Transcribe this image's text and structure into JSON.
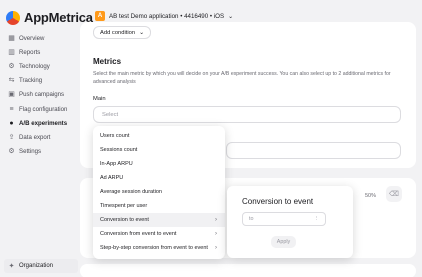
{
  "app": {
    "name": "AppMetrica",
    "title": "AB test Demo application • 4416490 • iOS",
    "badge": "A"
  },
  "sidebar": {
    "items": [
      {
        "label": "Overview",
        "icon": "overview-icon"
      },
      {
        "label": "Reports",
        "icon": "reports-icon"
      },
      {
        "label": "Technology",
        "icon": "technology-icon"
      },
      {
        "label": "Tracking",
        "icon": "tracking-icon"
      },
      {
        "label": "Push campaigns",
        "icon": "push-icon"
      },
      {
        "label": "Flag configuration",
        "icon": "flag-icon"
      },
      {
        "label": "A/B experiments",
        "icon": "ab-icon",
        "active": true
      },
      {
        "label": "Data export",
        "icon": "export-icon"
      },
      {
        "label": "Settings",
        "icon": "settings-icon"
      }
    ],
    "organization": "Organization"
  },
  "toolbar": {
    "add_condition": "Add condition"
  },
  "metrics": {
    "title": "Metrics",
    "description": "Select the main metric by which you will decide on your A/B experiment success. You can also select up to 2 additional metrics for advanced analysis",
    "main_label": "Main",
    "select_placeholder": "Select"
  },
  "variant": {
    "percent": "50%"
  },
  "dropdown": {
    "items": [
      {
        "label": "Users count",
        "has_submenu": false
      },
      {
        "label": "Sessions count",
        "has_submenu": false
      },
      {
        "label": "In-App ARPU",
        "has_submenu": false
      },
      {
        "label": "Ad ARPU",
        "has_submenu": false
      },
      {
        "label": "Average session duration",
        "has_submenu": false
      },
      {
        "label": "Timespent per user",
        "has_submenu": false
      },
      {
        "label": "Conversion to event",
        "has_submenu": true,
        "active": true
      },
      {
        "label": "Conversion from event to event",
        "has_submenu": true
      },
      {
        "label": "Step-by-step conversion from event to event",
        "has_submenu": true
      }
    ]
  },
  "submenu": {
    "title": "Conversion to event",
    "input_placeholder": "to",
    "apply_label": "Apply"
  },
  "colors": {
    "brand": "#ff9a1a",
    "background": "#f2f2f4",
    "card": "#ffffff"
  }
}
